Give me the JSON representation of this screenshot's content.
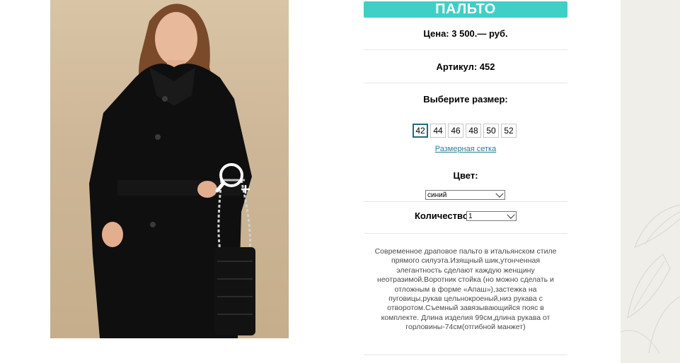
{
  "product": {
    "title": "ПАЛЬТО",
    "price": "Цена: 3 500.— руб.",
    "sku": "Артикул: 452",
    "size_prompt": "Выберите размер:",
    "sizes": [
      "42",
      "44",
      "46",
      "48",
      "50",
      "52"
    ],
    "selected_size": "42",
    "size_chart_link": "Размерная сетка",
    "color_label": "Цвет:",
    "color_value": "синий",
    "quantity_label": "Количество:",
    "quantity_value": "1",
    "description": "Современное драповое пальто в итальянском стиле прямого силуэта.Изящный шик,утонченная элегантность сделают каждую женщину неотразимой.Воротник стойка (но можно сделать и отложным в форме «Апаш»),застежка на пуговицы,рукав цельнокроеный,низ рукава с отворотом.Съемный завязывающийся пояс в комплекте. Длина изделия 99см,длина рукава от горловины-74см(отгибной манжет)"
  },
  "colors": {
    "accent": "#3ecfc6",
    "link": "#2f7f93",
    "side_panel": "#efeee9"
  },
  "icons": {
    "zoom": "magnifier-plus-icon",
    "dropdown": "chevron-down-icon"
  }
}
